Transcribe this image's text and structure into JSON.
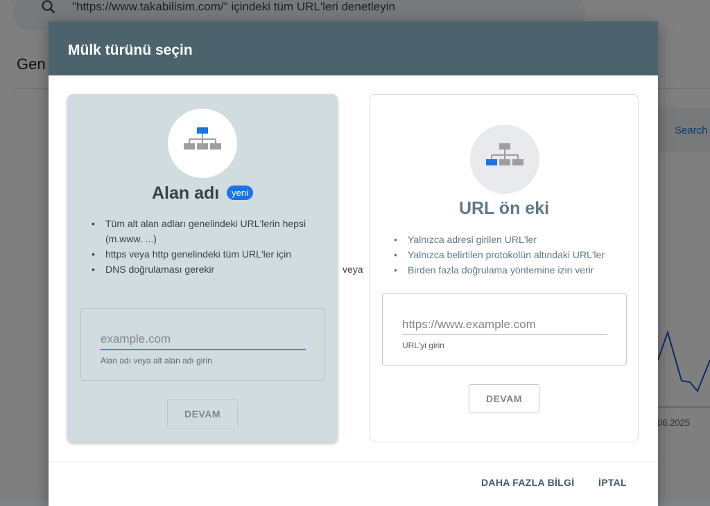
{
  "background": {
    "search_query": "\"https://www.takabilisim.com/\" içindeki tüm URL'leri denetleyin",
    "page_title_partial": "Gen",
    "search_link_partial": "Search",
    "date_partial": "06.2025"
  },
  "dialog": {
    "title": "Mülk türünü seçin",
    "separator": "veya",
    "domain_card": {
      "title": "Alan adı",
      "badge": "yeni",
      "icon": "sitemap-icon",
      "bullets": [
        "Tüm alt alan adları genelindeki URL'lerin hepsi (m.www. ...)",
        "https veya http genelindeki tüm URL'ler için",
        "DNS doğrulaması gerekir"
      ],
      "input_placeholder": "example.com",
      "input_hint": "Alan adı veya alt alan adı girin",
      "continue_label": "DEVAM"
    },
    "prefix_card": {
      "title": "URL ön eki",
      "icon": "sitemap-icon",
      "bullets": [
        "Yalnızca adresi girilen URL'ler",
        "Yalnızca belirtilen protokolün altındaki URL'ler",
        "Birden fazla doğrulama yöntemine izin verir"
      ],
      "input_placeholder": "https://www.example.com",
      "input_hint": "URL'yi girin",
      "continue_label": "DEVAM"
    },
    "footer": {
      "more_info_label": "DAHA FAZLA BİLGİ",
      "cancel_label": "İPTAL"
    }
  },
  "colors": {
    "header_bg": "#4c626c",
    "domain_card_bg": "#d1dce0",
    "accent_blue": "#1a73e8"
  }
}
